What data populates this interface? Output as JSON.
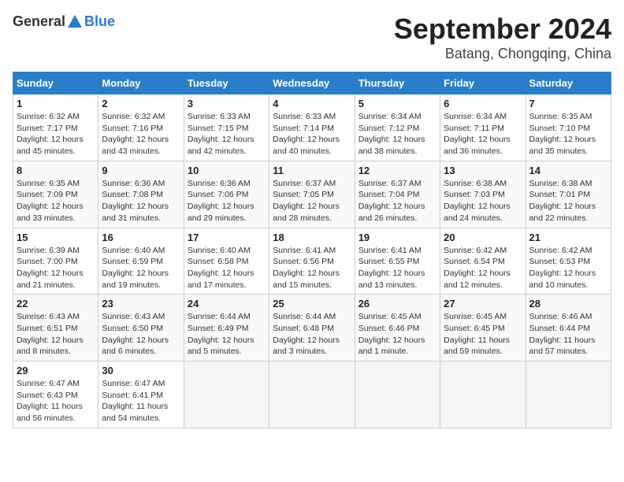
{
  "header": {
    "logo_general": "General",
    "logo_blue": "Blue",
    "month_title": "September 2024",
    "location": "Batang, Chongqing, China"
  },
  "calendar": {
    "columns": [
      "Sunday",
      "Monday",
      "Tuesday",
      "Wednesday",
      "Thursday",
      "Friday",
      "Saturday"
    ],
    "weeks": [
      [
        {
          "day": "1",
          "info": "Sunrise: 6:32 AM\nSunset: 7:17 PM\nDaylight: 12 hours\nand 45 minutes."
        },
        {
          "day": "2",
          "info": "Sunrise: 6:32 AM\nSunset: 7:16 PM\nDaylight: 12 hours\nand 43 minutes."
        },
        {
          "day": "3",
          "info": "Sunrise: 6:33 AM\nSunset: 7:15 PM\nDaylight: 12 hours\nand 42 minutes."
        },
        {
          "day": "4",
          "info": "Sunrise: 6:33 AM\nSunset: 7:14 PM\nDaylight: 12 hours\nand 40 minutes."
        },
        {
          "day": "5",
          "info": "Sunrise: 6:34 AM\nSunset: 7:12 PM\nDaylight: 12 hours\nand 38 minutes."
        },
        {
          "day": "6",
          "info": "Sunrise: 6:34 AM\nSunset: 7:11 PM\nDaylight: 12 hours\nand 36 minutes."
        },
        {
          "day": "7",
          "info": "Sunrise: 6:35 AM\nSunset: 7:10 PM\nDaylight: 12 hours\nand 35 minutes."
        }
      ],
      [
        {
          "day": "8",
          "info": "Sunrise: 6:35 AM\nSunset: 7:09 PM\nDaylight: 12 hours\nand 33 minutes."
        },
        {
          "day": "9",
          "info": "Sunrise: 6:36 AM\nSunset: 7:08 PM\nDaylight: 12 hours\nand 31 minutes."
        },
        {
          "day": "10",
          "info": "Sunrise: 6:36 AM\nSunset: 7:06 PM\nDaylight: 12 hours\nand 29 minutes."
        },
        {
          "day": "11",
          "info": "Sunrise: 6:37 AM\nSunset: 7:05 PM\nDaylight: 12 hours\nand 28 minutes."
        },
        {
          "day": "12",
          "info": "Sunrise: 6:37 AM\nSunset: 7:04 PM\nDaylight: 12 hours\nand 26 minutes."
        },
        {
          "day": "13",
          "info": "Sunrise: 6:38 AM\nSunset: 7:03 PM\nDaylight: 12 hours\nand 24 minutes."
        },
        {
          "day": "14",
          "info": "Sunrise: 6:38 AM\nSunset: 7:01 PM\nDaylight: 12 hours\nand 22 minutes."
        }
      ],
      [
        {
          "day": "15",
          "info": "Sunrise: 6:39 AM\nSunset: 7:00 PM\nDaylight: 12 hours\nand 21 minutes."
        },
        {
          "day": "16",
          "info": "Sunrise: 6:40 AM\nSunset: 6:59 PM\nDaylight: 12 hours\nand 19 minutes."
        },
        {
          "day": "17",
          "info": "Sunrise: 6:40 AM\nSunset: 6:58 PM\nDaylight: 12 hours\nand 17 minutes."
        },
        {
          "day": "18",
          "info": "Sunrise: 6:41 AM\nSunset: 6:56 PM\nDaylight: 12 hours\nand 15 minutes."
        },
        {
          "day": "19",
          "info": "Sunrise: 6:41 AM\nSunset: 6:55 PM\nDaylight: 12 hours\nand 13 minutes."
        },
        {
          "day": "20",
          "info": "Sunrise: 6:42 AM\nSunset: 6:54 PM\nDaylight: 12 hours\nand 12 minutes."
        },
        {
          "day": "21",
          "info": "Sunrise: 6:42 AM\nSunset: 6:53 PM\nDaylight: 12 hours\nand 10 minutes."
        }
      ],
      [
        {
          "day": "22",
          "info": "Sunrise: 6:43 AM\nSunset: 6:51 PM\nDaylight: 12 hours\nand 8 minutes."
        },
        {
          "day": "23",
          "info": "Sunrise: 6:43 AM\nSunset: 6:50 PM\nDaylight: 12 hours\nand 6 minutes."
        },
        {
          "day": "24",
          "info": "Sunrise: 6:44 AM\nSunset: 6:49 PM\nDaylight: 12 hours\nand 5 minutes."
        },
        {
          "day": "25",
          "info": "Sunrise: 6:44 AM\nSunset: 6:48 PM\nDaylight: 12 hours\nand 3 minutes."
        },
        {
          "day": "26",
          "info": "Sunrise: 6:45 AM\nSunset: 6:46 PM\nDaylight: 12 hours\nand 1 minute."
        },
        {
          "day": "27",
          "info": "Sunrise: 6:45 AM\nSunset: 6:45 PM\nDaylight: 11 hours\nand 59 minutes."
        },
        {
          "day": "28",
          "info": "Sunrise: 6:46 AM\nSunset: 6:44 PM\nDaylight: 11 hours\nand 57 minutes."
        }
      ],
      [
        {
          "day": "29",
          "info": "Sunrise: 6:47 AM\nSunset: 6:43 PM\nDaylight: 11 hours\nand 56 minutes."
        },
        {
          "day": "30",
          "info": "Sunrise: 6:47 AM\nSunset: 6:41 PM\nDaylight: 11 hours\nand 54 minutes."
        },
        {
          "day": "",
          "info": ""
        },
        {
          "day": "",
          "info": ""
        },
        {
          "day": "",
          "info": ""
        },
        {
          "day": "",
          "info": ""
        },
        {
          "day": "",
          "info": ""
        }
      ]
    ]
  }
}
